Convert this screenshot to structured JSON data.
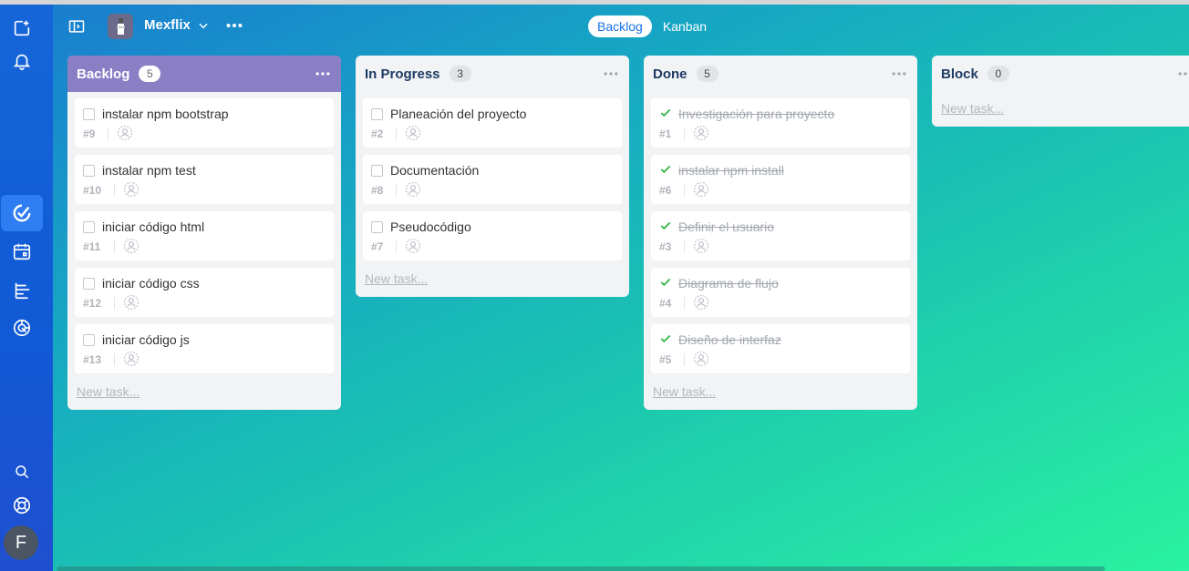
{
  "project": {
    "name": "Mexflix"
  },
  "views": [
    {
      "label": "Backlog",
      "active": true
    },
    {
      "label": "Kanban",
      "active": false
    }
  ],
  "user": {
    "initial": "F"
  },
  "columns": [
    {
      "title": "Backlog",
      "count": "5",
      "new_task": "New task...",
      "cards": [
        {
          "title": "instalar npm bootstrap",
          "id": "#9",
          "done": false
        },
        {
          "title": "instalar npm test",
          "id": "#10",
          "done": false
        },
        {
          "title": "iniciar código html",
          "id": "#11",
          "done": false
        },
        {
          "title": "iniciar código css",
          "id": "#12",
          "done": false
        },
        {
          "title": "iniciar código js",
          "id": "#13",
          "done": false
        }
      ]
    },
    {
      "title": "In Progress",
      "count": "3",
      "new_task": "New task...",
      "cards": [
        {
          "title": "Planeación del proyecto",
          "id": "#2",
          "done": false
        },
        {
          "title": "Documentación",
          "id": "#8",
          "done": false
        },
        {
          "title": "Pseudocódigo",
          "id": "#7",
          "done": false
        }
      ]
    },
    {
      "title": "Done",
      "count": "5",
      "new_task": "New task...",
      "cards": [
        {
          "title": "Investigación para proyecto",
          "id": "#1",
          "done": true
        },
        {
          "title": "instalar npm install",
          "id": "#6",
          "done": true
        },
        {
          "title": "Definir el usuario",
          "id": "#3",
          "done": true
        },
        {
          "title": "Diagrama de flujo",
          "id": "#4",
          "done": true
        },
        {
          "title": "Diseño de interfaz",
          "id": "#5",
          "done": true
        }
      ]
    },
    {
      "title": "Block",
      "count": "0",
      "new_task": "New task...",
      "cards": []
    }
  ],
  "colors": {
    "accent": "#1a73e8",
    "backlog_header": "#8a7fc4",
    "done_check": "#2fb344"
  }
}
